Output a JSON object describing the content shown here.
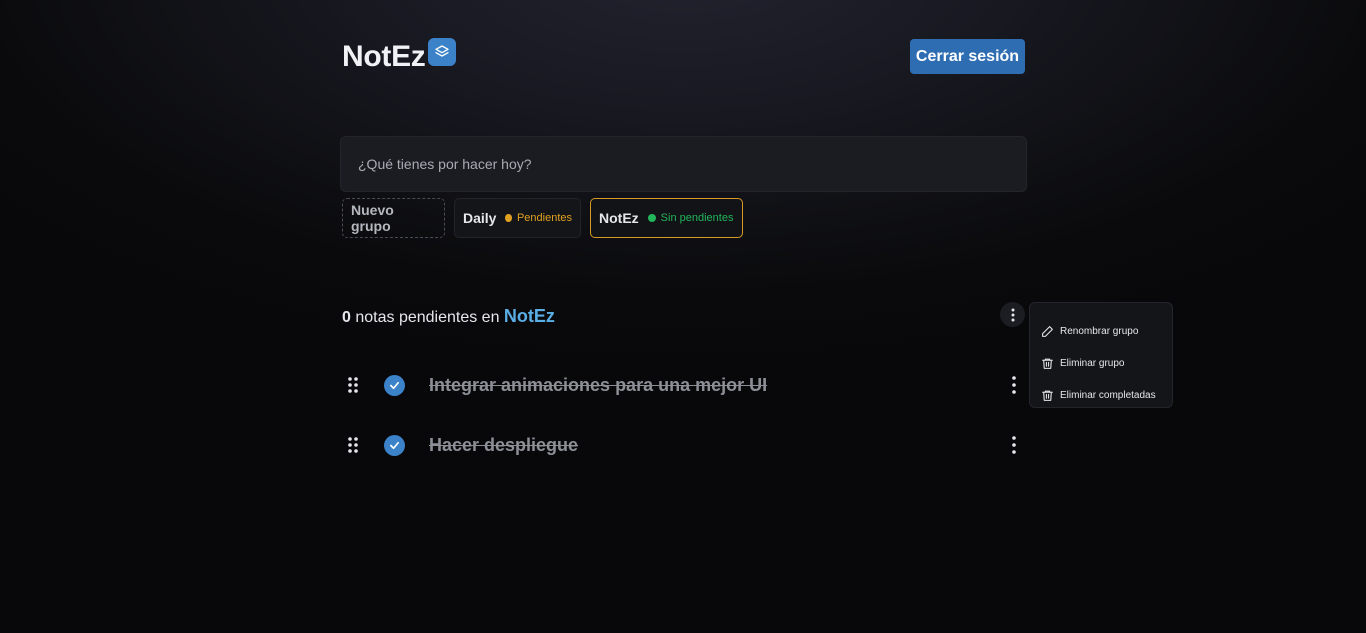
{
  "app": {
    "title": "NotEz",
    "logout_label": "Cerrar sesión"
  },
  "input": {
    "placeholder": "¿Qué tienes por hacer hoy?",
    "value": ""
  },
  "groups": {
    "new_label": "Nuevo grupo",
    "items": [
      {
        "name": "Daily",
        "status": "Pendientes",
        "status_color": "#e0a020"
      },
      {
        "name": "NotEz",
        "status": "Sin pendientes",
        "status_color": "#22b55a",
        "active": true
      }
    ]
  },
  "summary": {
    "count": "0",
    "text": " notas pendientes en ",
    "group_name": "NotEz"
  },
  "group_menu": {
    "items": [
      {
        "label": "Renombrar grupo",
        "icon": "pencil-icon"
      },
      {
        "label": "Eliminar grupo",
        "icon": "trash-icon"
      },
      {
        "label": "Eliminar completadas",
        "icon": "trash-icon"
      }
    ]
  },
  "tasks": [
    {
      "text": "Integrar animaciones para una mejor UI",
      "completed": true
    },
    {
      "text": "Hacer despliegue",
      "completed": true
    }
  ],
  "colors": {
    "accent": "#3b82c8",
    "button": "#2f6db3",
    "active_border": "#d99a24",
    "group_highlight": "#5aaee6"
  }
}
